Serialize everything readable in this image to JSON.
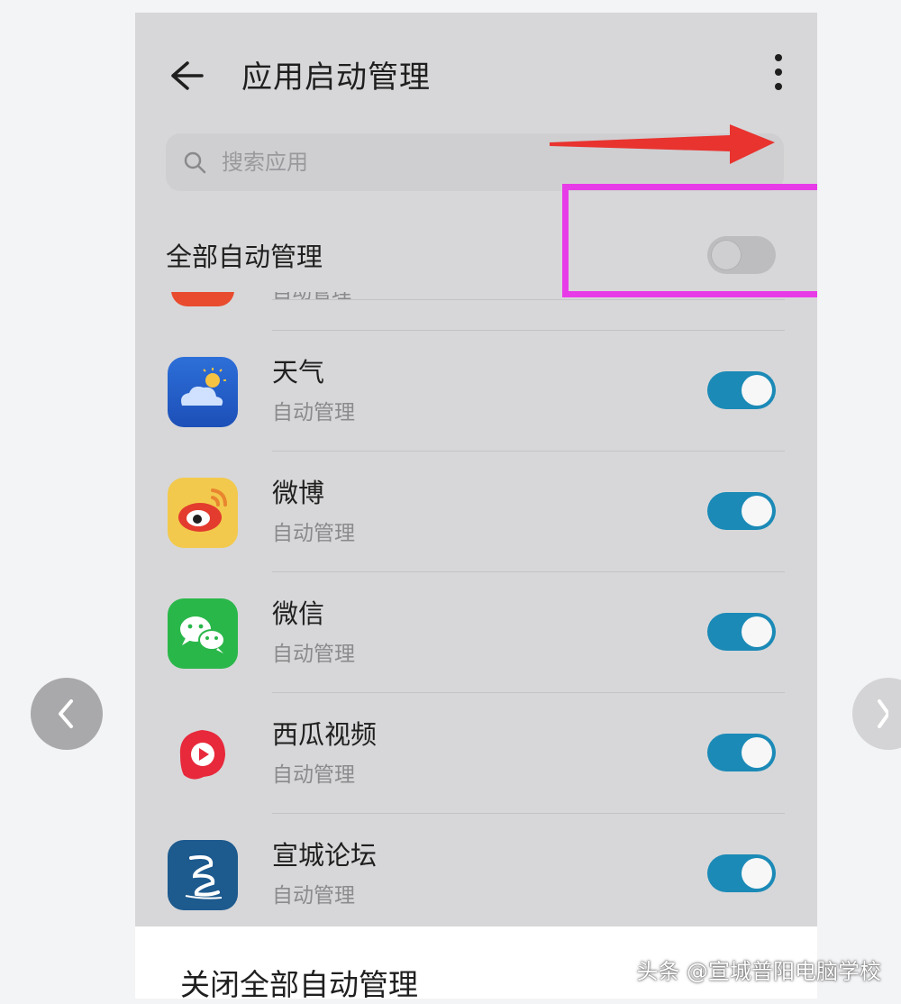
{
  "header": {
    "title": "应用启动管理"
  },
  "search": {
    "placeholder": "搜索应用"
  },
  "all_auto": {
    "label": "全部自动管理",
    "enabled": false
  },
  "partial_row": {
    "subtitle": "自动管理"
  },
  "apps": [
    {
      "name": "天气",
      "status": "自动管理",
      "enabled": true
    },
    {
      "name": "微博",
      "status": "自动管理",
      "enabled": true
    },
    {
      "name": "微信",
      "status": "自动管理",
      "enabled": true
    },
    {
      "name": "西瓜视频",
      "status": "自动管理",
      "enabled": true
    },
    {
      "name": "宣城论坛",
      "status": "自动管理",
      "enabled": true
    }
  ],
  "bottom": {
    "label": "关闭全部自动管理"
  },
  "watermark": "头条 @宣城普阳电脑学校",
  "colors": {
    "toggle_on": "#1b8ab7",
    "highlight": "#e83be8",
    "arrow": "#e8332f"
  }
}
